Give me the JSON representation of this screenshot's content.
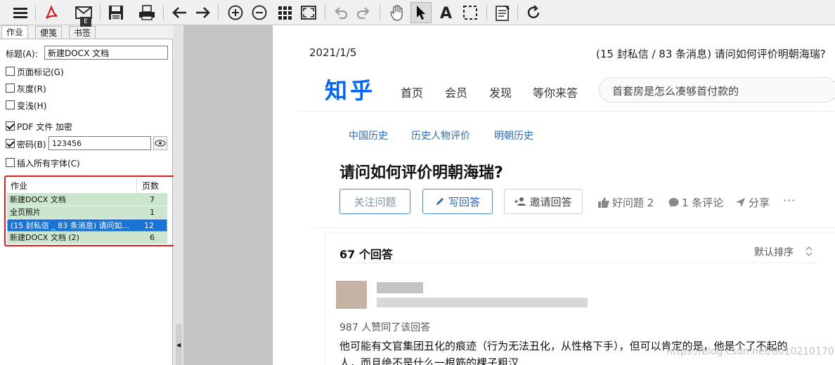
{
  "toolbar": {
    "icons": [
      "menu-icon",
      "pdf-icon",
      "email-icon",
      "save-icon",
      "print-icon",
      "back-icon",
      "forward-icon",
      "zoom-in-icon",
      "zoom-out-icon",
      "grid-icon",
      "fit-page-icon",
      "undo-icon",
      "redo-icon",
      "hand-icon",
      "pointer-icon",
      "text-icon",
      "selection-icon",
      "notes-icon",
      "refresh-icon"
    ],
    "email_badge": "E"
  },
  "tabs": [
    "作业",
    "便笺",
    "书签"
  ],
  "form": {
    "title_label": "标题(A):",
    "title_value": "新建DOCX 文档",
    "page_mark": "页面标记(G)",
    "grayscale": "灰度(R)",
    "lighten": "变浅(H)",
    "pdf_encrypt": "PDF 文件 加密",
    "password_label": "密码(B)",
    "password_value": "123456",
    "embed_fonts": "插入所有字体(C)"
  },
  "jobs": {
    "col_job": "作业",
    "col_pages": "页数",
    "rows": [
      {
        "name": "新建DOCX 文档",
        "pages": "7"
      },
      {
        "name": "全页照片",
        "pages": "1"
      },
      {
        "name": "(15 封私信 _ 83 条消息) 请问如...",
        "pages": "12"
      },
      {
        "name": "新建DOCX 文档 (2)",
        "pages": "6"
      }
    ]
  },
  "preview": {
    "date": "2021/1/5",
    "header_title": "(15 封私信 / 83 条消息) 请问如何评价明朝海瑞?",
    "logo": "知乎",
    "nav": [
      "首页",
      "会员",
      "发现",
      "等你来答"
    ],
    "search_placeholder": "首套房是怎么凑够首付款的",
    "topics": [
      "中国历史",
      "历史人物评价",
      "明朝历史"
    ],
    "question": "请问如何评价明朝海瑞?",
    "follow_btn": "关注问题",
    "answer_btn": "写回答",
    "invite_btn": "邀请回答",
    "good_question": "好问题 2",
    "comments": "1 条评论",
    "share": "分享",
    "more": "···",
    "answer_count": "67 个回答",
    "sort": "默认排序",
    "upvotes": "987 人赞同了该回答",
    "answer_line1": "他可能有文官集团丑化的痕迹（行为无法丑化，从性格下手），但可以肯定的是，他是个了不起的",
    "answer_line2": "人，而且绝不是什么一根筋的棵子粗汉",
    "watermark": "https://blog.csdn.net/u010210170"
  },
  "colors": {
    "zhihu_blue": "#0066ff",
    "selection_red": "#e02020",
    "row_green": "#cbe6cc",
    "row_selected": "#1a73d6"
  }
}
